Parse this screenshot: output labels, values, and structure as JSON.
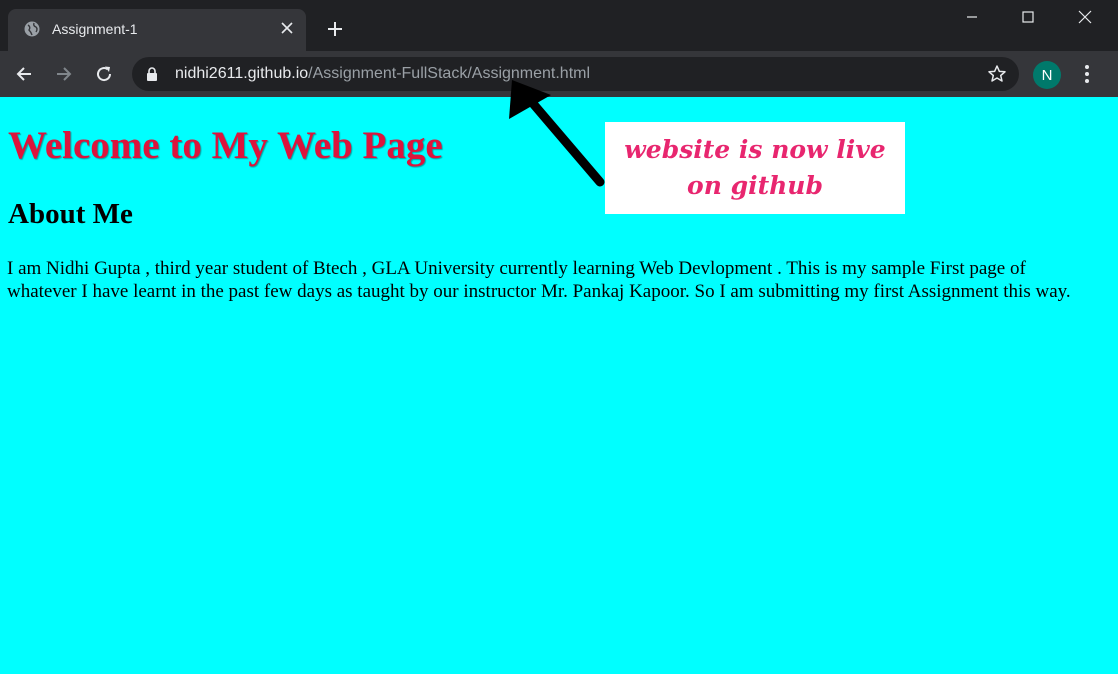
{
  "browser": {
    "tab": {
      "title": "Assignment-1"
    },
    "address_bar": {
      "host": "nidhi2611.github.io",
      "path": "/Assignment-FullStack/Assignment.html"
    },
    "profile_initial": "N",
    "icons": [
      "globe-icon",
      "tab-close-icon",
      "new-tab-icon",
      "minimize-icon",
      "maximize-icon",
      "close-window-icon",
      "back-arrow-icon",
      "forward-arrow-icon",
      "reload-icon",
      "lock-icon",
      "star-icon",
      "more-menu-icon"
    ]
  },
  "page": {
    "background": "#00ffff",
    "heading": "Welcome to My Web Page",
    "heading_color": "#dc143c",
    "subheading": "About Me",
    "paragraph": "I am Nidhi Gupta , third year student of Btech , GLA University currently learning Web Devlopment . This is my sample First page of whatever I have learnt in the past few days as taught by our instructor Mr. Pankaj Kapoor. So I am submitting my first Assignment this way."
  },
  "annotation": {
    "text": "website is now live on github",
    "color": "#e8266f"
  }
}
